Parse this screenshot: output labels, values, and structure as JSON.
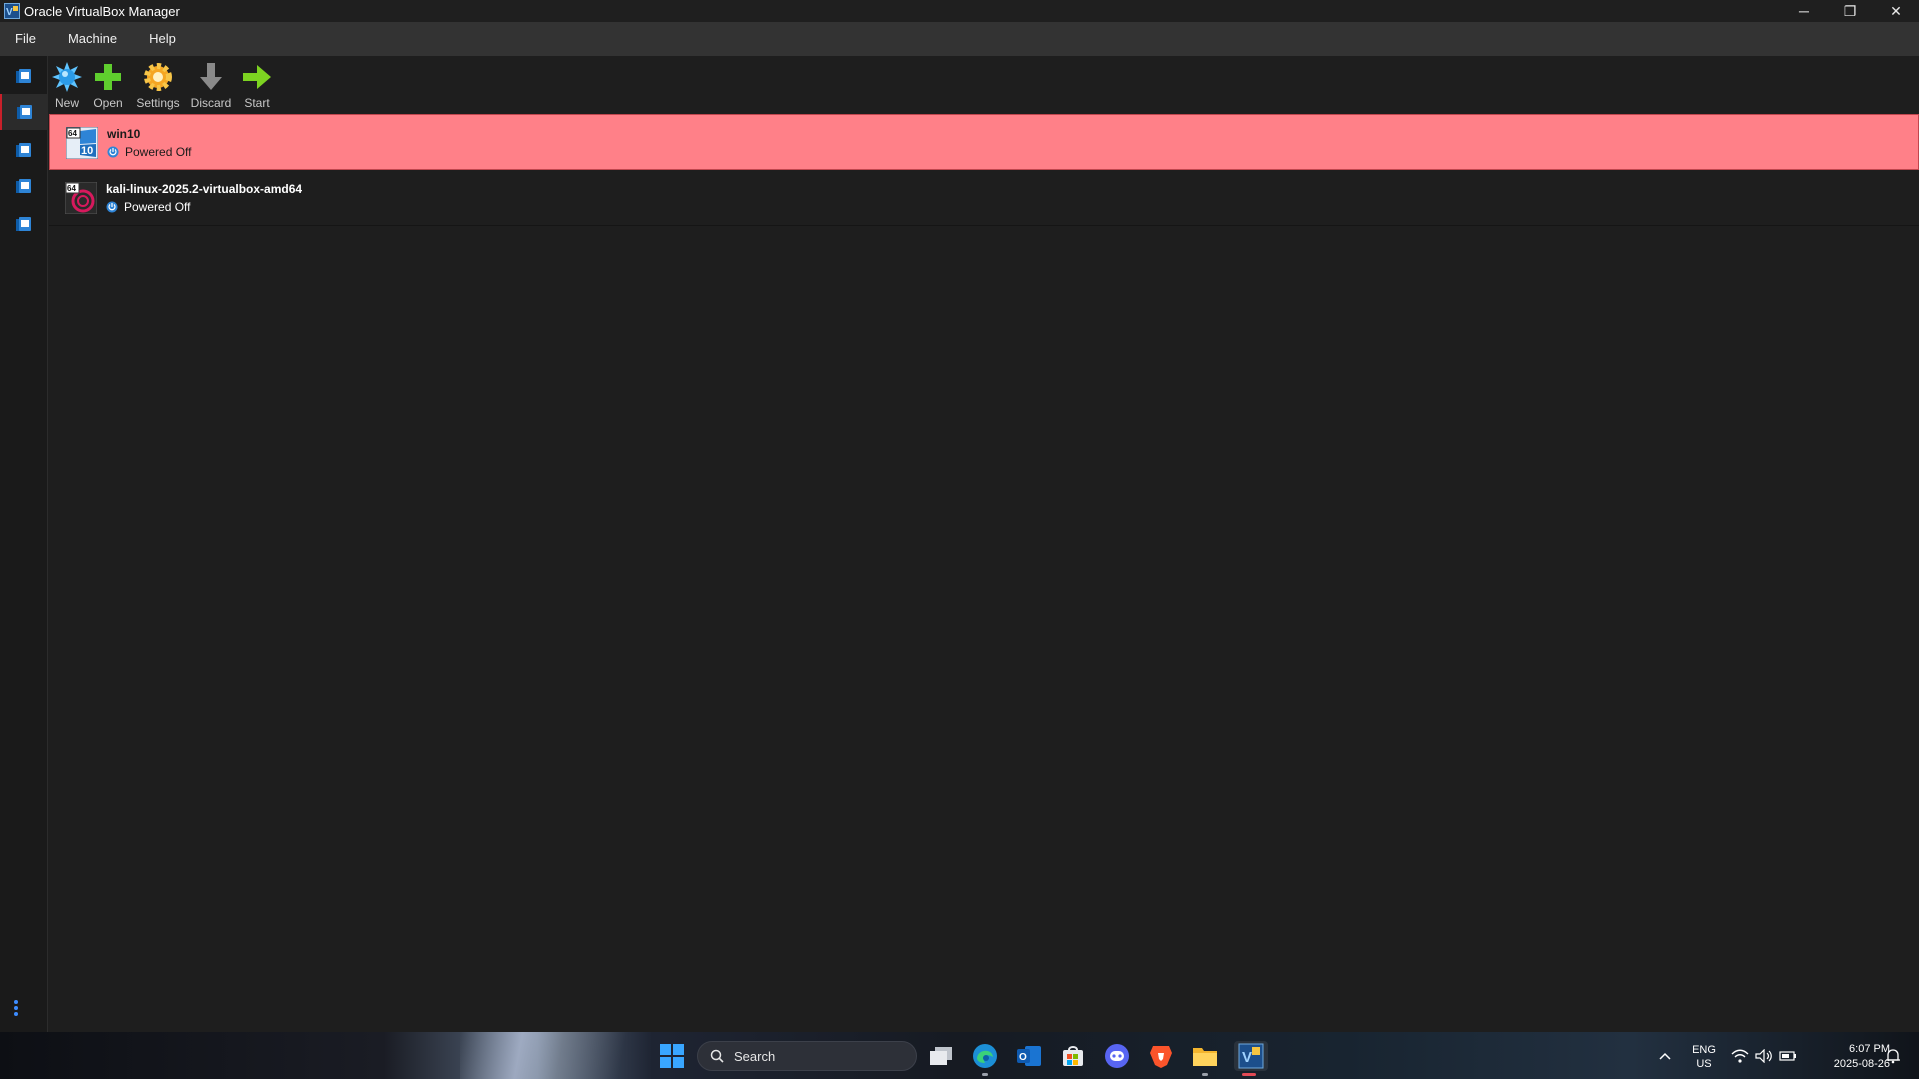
{
  "window": {
    "title": "Oracle VirtualBox Manager",
    "minimize": "─",
    "restore": "❐",
    "close": "✕"
  },
  "menu": {
    "items": [
      "File",
      "Machine",
      "Help"
    ]
  },
  "sidebar": {
    "tools": [
      {
        "name": "welcome-tool",
        "active": false
      },
      {
        "name": "machines-tool",
        "active": true
      },
      {
        "name": "media-tool",
        "active": false
      },
      {
        "name": "extensions-tool",
        "active": false
      },
      {
        "name": "activities-tool",
        "active": false
      }
    ]
  },
  "toolbar": {
    "new_label": "New",
    "open_label": "Open",
    "settings_label": "Settings",
    "discard_label": "Discard",
    "start_label": "Start"
  },
  "vms": [
    {
      "name": "win10",
      "state": "Powered Off",
      "os_badge": "64",
      "os_ver": "10",
      "selected": true
    },
    {
      "name": "kali-linux-2025.2-virtualbox-amd64",
      "state": "Powered Off",
      "os_badge": "64",
      "selected": false
    }
  ],
  "taskbar": {
    "search_placeholder": "Search",
    "lang_line1": "ENG",
    "lang_line2": "US",
    "time": "6:07 PM",
    "date": "2025-08-26"
  },
  "colors": {
    "selected_row": "#ff8088",
    "accent_blue": "#2e84d6",
    "start_green": "#7dd321",
    "settings_orange": "#f5a623"
  }
}
